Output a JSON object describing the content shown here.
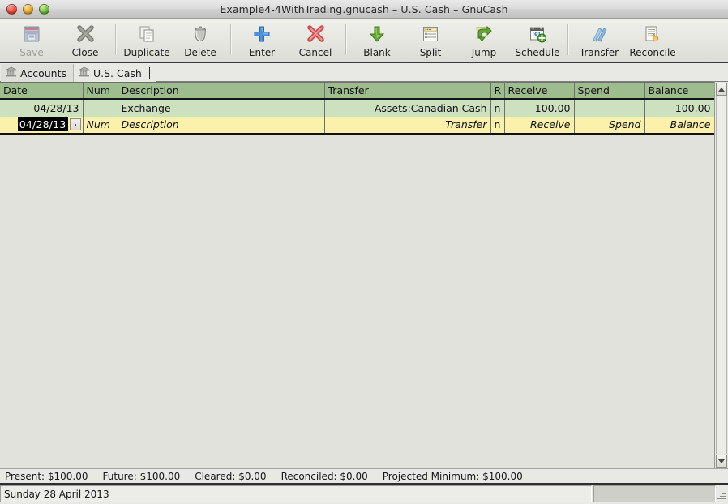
{
  "window": {
    "title": "Example4-4WithTrading.gnucash – U.S. Cash – GnuCash",
    "controls": {
      "close": "close-button",
      "minimize": "minimize-button",
      "zoom": "zoom-button"
    }
  },
  "toolbar": {
    "items": [
      {
        "label": "Save",
        "icon": "save-icon",
        "disabled": true
      },
      {
        "label": "Close",
        "icon": "close-x-icon",
        "disabled": false
      },
      {
        "label": "Duplicate",
        "icon": "duplicate-icon",
        "disabled": false
      },
      {
        "label": "Delete",
        "icon": "trash-icon",
        "disabled": false
      },
      {
        "label": "Enter",
        "icon": "plus-icon",
        "disabled": false
      },
      {
        "label": "Cancel",
        "icon": "cancel-x-icon",
        "disabled": false
      },
      {
        "label": "Blank",
        "icon": "down-arrow-icon",
        "disabled": false
      },
      {
        "label": "Split",
        "icon": "split-icon",
        "disabled": false
      },
      {
        "label": "Jump",
        "icon": "jump-icon",
        "disabled": false
      },
      {
        "label": "Schedule",
        "icon": "calendar-icon",
        "disabled": false
      },
      {
        "label": "Transfer",
        "icon": "transfer-icon",
        "disabled": false
      },
      {
        "label": "Reconcile",
        "icon": "reconcile-icon",
        "disabled": false
      }
    ]
  },
  "tabs": [
    {
      "label": "Accounts",
      "icon": "bank-icon",
      "active": false
    },
    {
      "label": "U.S. Cash",
      "icon": "bank-icon",
      "active": true
    }
  ],
  "register": {
    "columns": [
      "Date",
      "Num",
      "Description",
      "Transfer",
      "R",
      "Receive",
      "Spend",
      "Balance"
    ],
    "rows": [
      {
        "type": "transaction",
        "date": "04/28/13",
        "num": "",
        "description": "Exchange",
        "transfer": "Assets:Canadian Cash",
        "r": "n",
        "receive": "100.00",
        "spend": "",
        "balance": "100.00"
      },
      {
        "type": "blank",
        "date": "04/28/13",
        "num": "Num",
        "description": "Description",
        "transfer": "Transfer",
        "r": "n",
        "receive": "Receive",
        "spend": "Spend",
        "balance": "Balance"
      }
    ]
  },
  "summary": {
    "present": "Present: $100.00",
    "future": "Future: $100.00",
    "cleared": "Cleared: $0.00",
    "reconciled": "Reconciled: $0.00",
    "projected_minimum": "Projected Minimum: $100.00"
  },
  "status": {
    "message": "Sunday 28 April 2013",
    "progress": ""
  },
  "colors": {
    "header_green": "#9dbd8f",
    "row_green": "#cde1c1",
    "blank_yellow": "#fcf1ab",
    "chrome": "#e8e8e4",
    "ghost_text": "#a09a6e"
  }
}
